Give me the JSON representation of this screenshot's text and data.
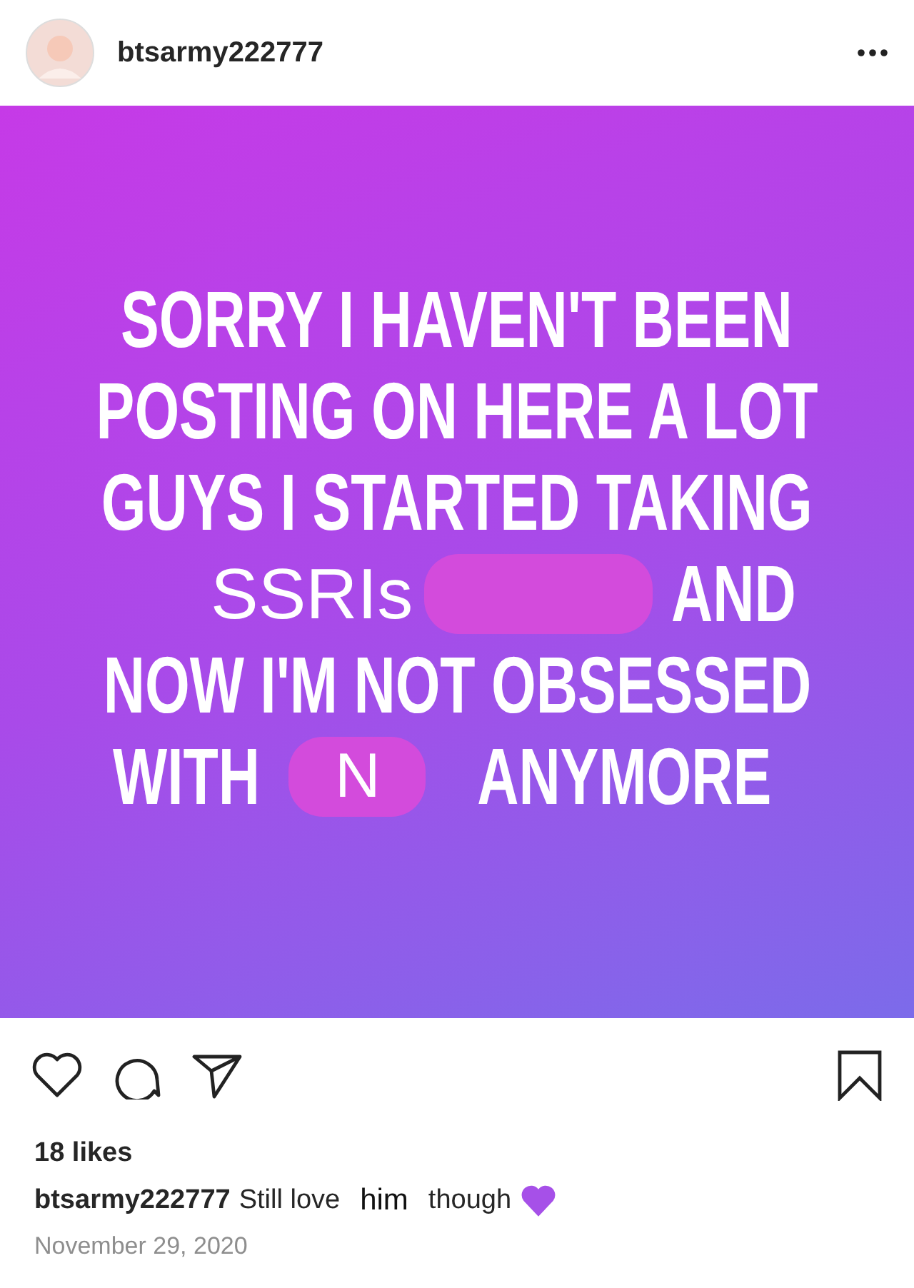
{
  "header": {
    "username": "btsarmy222777"
  },
  "post_image": {
    "lines": [
      {
        "segments": [
          {
            "kind": "caps",
            "text": "SORRY I HAVEN'T BEEN"
          }
        ]
      },
      {
        "segments": [
          {
            "kind": "caps",
            "text": "POSTING ON HERE A LOT"
          }
        ]
      },
      {
        "segments": [
          {
            "kind": "caps",
            "text": "GUYS I STARTED TAKING"
          }
        ]
      },
      {
        "segments": [
          {
            "kind": "overlay",
            "text": "SSRIs"
          },
          {
            "kind": "blob"
          },
          {
            "kind": "caps",
            "text": "AND"
          }
        ]
      },
      {
        "segments": [
          {
            "kind": "caps",
            "text": "NOW I'M NOT OBSESSED"
          }
        ]
      },
      {
        "segments": [
          {
            "kind": "caps",
            "text": "WITH"
          },
          {
            "kind": "blob",
            "text": "N"
          },
          {
            "kind": "caps",
            "text": "ANYMORE"
          }
        ]
      }
    ]
  },
  "likes": "18 likes",
  "caption": {
    "username": "btsarmy222777",
    "parts": [
      {
        "kind": "plain",
        "text": "Still love"
      },
      {
        "kind": "edited",
        "text": "him"
      },
      {
        "kind": "plain",
        "text": "though"
      }
    ]
  },
  "date": "November 29, 2020"
}
